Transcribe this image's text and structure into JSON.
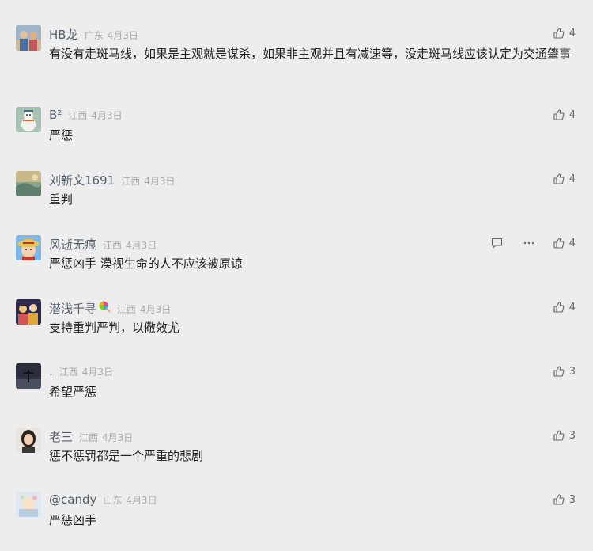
{
  "comments": [
    {
      "name": "HB龙",
      "location": "广东",
      "date": "4月3日",
      "text": "有没有走斑马线，如果是主观就是谋杀，如果非主观并且有减速等，没走斑马线应该认定为交通肇事",
      "likes": "4",
      "avatar_icon": "avatar-photo-group"
    },
    {
      "name": "B²",
      "location": "江西",
      "date": "4月3日",
      "text": "严惩",
      "likes": "4",
      "avatar_icon": "avatar-snowman"
    },
    {
      "name": "刘新文1691",
      "location": "江西",
      "date": "4月3日",
      "text": "重判",
      "likes": "4",
      "avatar_icon": "avatar-painting"
    },
    {
      "name": "风逝无痕",
      "location": "江西",
      "date": "4月3日",
      "text": "严惩凶手 漠视生命的人不应该被原谅",
      "likes": "4",
      "avatar_icon": "avatar-cartoon-straw-hat",
      "show_extra_actions": true
    },
    {
      "name": "潜浅千寻",
      "location": "江西",
      "date": "4月3日",
      "text": "支持重判严判，以儆效尤",
      "likes": "4",
      "avatar_icon": "avatar-anime-group",
      "name_emoji": "lollipop-emoji"
    },
    {
      "name": ".",
      "location": "江西",
      "date": "4月3日",
      "text": "希望严惩",
      "likes": "3",
      "avatar_icon": "avatar-silhouette-dusk"
    },
    {
      "name": "老三",
      "location": "江西",
      "date": "4月3日",
      "text": "惩不惩罚都是一个严重的悲剧",
      "likes": "3",
      "avatar_icon": "avatar-portrait-girl"
    },
    {
      "name": "@candy",
      "location": "山东",
      "date": "4月3日",
      "text": "严惩凶手",
      "likes": "3",
      "avatar_icon": "avatar-pastel-illustration"
    }
  ],
  "icons": {
    "reply": "comment-bubble-icon",
    "more": "more-dots-icon",
    "like": "thumbs-up-icon"
  },
  "colors": {
    "background": "#ededed",
    "name": "#555e6a",
    "meta": "#a9a9a9",
    "text": "#1f1f1f"
  }
}
